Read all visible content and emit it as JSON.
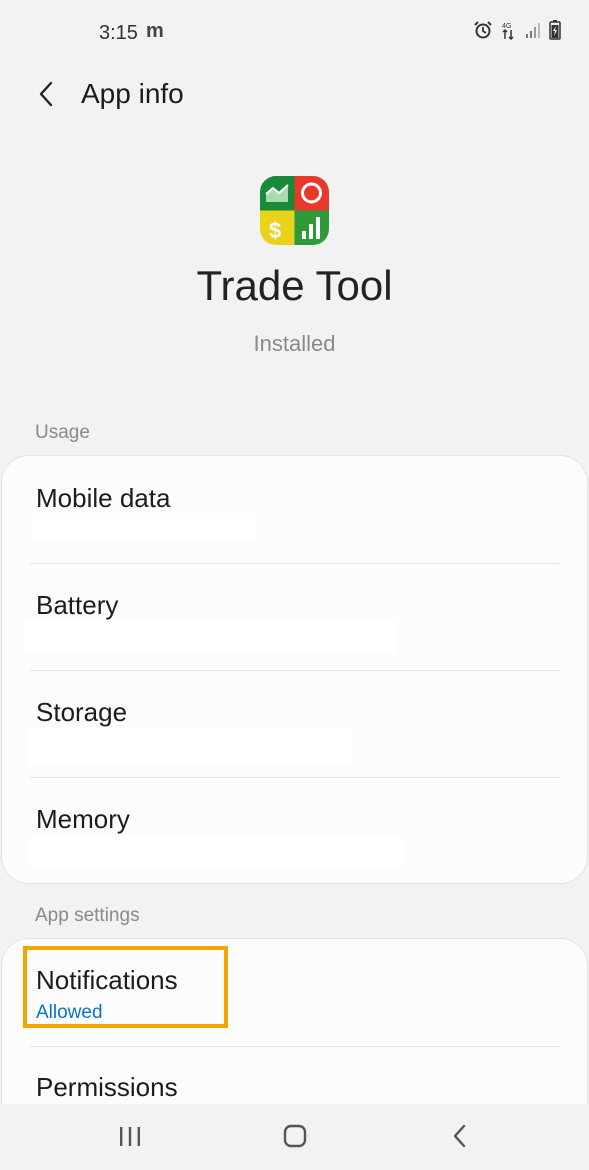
{
  "status_bar": {
    "time": "3:15",
    "notification_glyph": "m"
  },
  "app_bar": {
    "title": "App info"
  },
  "app": {
    "name": "Trade Tool",
    "status": "Installed",
    "icon_colors": {
      "top_left": "#1a8a3a",
      "top_right": "#e8392a",
      "bottom_left": "#e8d21a",
      "bottom_right": "#2f9a3a"
    }
  },
  "usage": {
    "header": "Usage",
    "items": [
      {
        "label": "Mobile data"
      },
      {
        "label": "Battery"
      },
      {
        "label": "Storage"
      },
      {
        "label": "Memory"
      }
    ]
  },
  "app_settings": {
    "header": "App settings",
    "items": [
      {
        "label": "Notifications",
        "sub": "Allowed"
      },
      {
        "label": "Permissions"
      }
    ]
  },
  "nav": {
    "recent_icon": "recent-apps-icon",
    "home_icon": "home-icon",
    "back_icon": "back-icon"
  },
  "colors": {
    "accent": "#0a72c8",
    "highlight": "#f0a500"
  }
}
